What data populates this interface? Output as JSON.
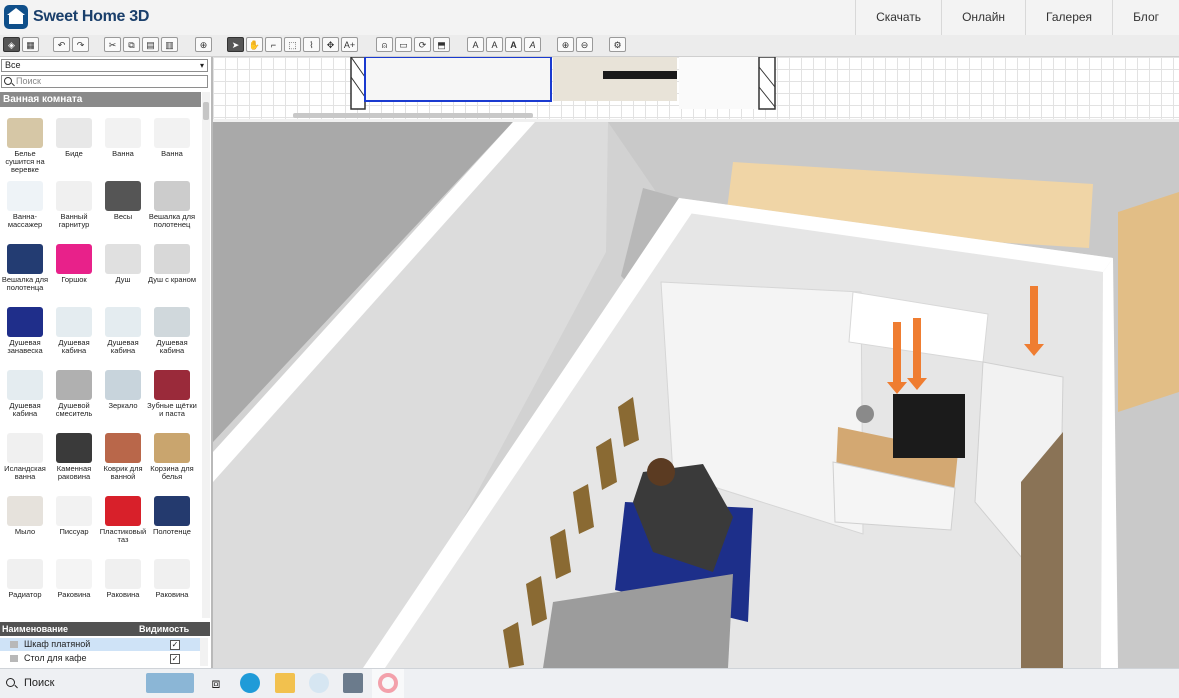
{
  "app": {
    "title": "Sweet Home 3D"
  },
  "nav": {
    "items": [
      "Скачать",
      "Онлайн",
      "Галерея",
      "Блог"
    ]
  },
  "toolbar": {
    "text_buttons": [
      "A",
      "A",
      "A",
      "A"
    ]
  },
  "catalog": {
    "category_select": "Все",
    "search_placeholder": "Поиск",
    "category_header": "Ванная комната",
    "items": [
      {
        "label": "Белье сушится на веревке",
        "icon": "laundry-line-icon"
      },
      {
        "label": "Биде",
        "icon": "bidet-icon"
      },
      {
        "label": "Ванна",
        "icon": "bathtub-icon"
      },
      {
        "label": "Ванна",
        "icon": "bathtub-icon"
      },
      {
        "label": "Ванна-массажер",
        "icon": "jacuzzi-icon"
      },
      {
        "label": "Ванный гарнитур",
        "icon": "bath-furniture-icon"
      },
      {
        "label": "Весы",
        "icon": "scale-icon"
      },
      {
        "label": "Вешалка для полотенец",
        "icon": "towel-rack-icon"
      },
      {
        "label": "Вешалка для полотенца",
        "icon": "towel-hanger-icon"
      },
      {
        "label": "Горшок",
        "icon": "potty-icon"
      },
      {
        "label": "Душ",
        "icon": "shower-icon"
      },
      {
        "label": "Душ с краном",
        "icon": "shower-tap-icon"
      },
      {
        "label": "Душевая занавеска",
        "icon": "shower-curtain-icon"
      },
      {
        "label": "Душевая кабина",
        "icon": "shower-cabin-icon"
      },
      {
        "label": "Душевая кабина",
        "icon": "shower-cabin-icon"
      },
      {
        "label": "Душевая кабина",
        "icon": "shower-cabin-icon"
      },
      {
        "label": "Душевая кабина",
        "icon": "shower-cabin-icon"
      },
      {
        "label": "Душевой смеситель",
        "icon": "shower-mixer-icon"
      },
      {
        "label": "Зеркало",
        "icon": "mirror-icon"
      },
      {
        "label": "Зубные щётки и паста",
        "icon": "toothbrushes-icon"
      },
      {
        "label": "Исландская ванна",
        "icon": "icelandic-bath-icon"
      },
      {
        "label": "Каменная раковина",
        "icon": "stone-sink-icon"
      },
      {
        "label": "Коврик для ванной",
        "icon": "bath-mat-icon"
      },
      {
        "label": "Корзина для белья",
        "icon": "laundry-basket-icon"
      },
      {
        "label": "Мыло",
        "icon": "soap-icon"
      },
      {
        "label": "Писсуар",
        "icon": "urinal-icon"
      },
      {
        "label": "Пластиковый таз",
        "icon": "plastic-basin-icon"
      },
      {
        "label": "Полотенце",
        "icon": "towel-icon"
      },
      {
        "label": "Радиатор",
        "icon": "radiator-icon"
      },
      {
        "label": "Раковина",
        "icon": "sink-icon"
      },
      {
        "label": "Раковина",
        "icon": "sink-icon"
      },
      {
        "label": "Раковина",
        "icon": "sink-icon"
      }
    ]
  },
  "furniture_list": {
    "columns": [
      "Наименование",
      "Видимость"
    ],
    "rows": [
      {
        "name": "Шкаф платяной",
        "visible": "✓",
        "selected": true
      },
      {
        "name": "Стол для кафе",
        "visible": "✓",
        "selected": false
      }
    ]
  },
  "taskbar": {
    "search_label": "Поиск"
  },
  "colors": {
    "accent": "#ef7d31",
    "catalog_header": "#8a8a8a",
    "list_header": "#525252",
    "selection": "#cfe3f7",
    "brand": "#0f4f8a"
  }
}
